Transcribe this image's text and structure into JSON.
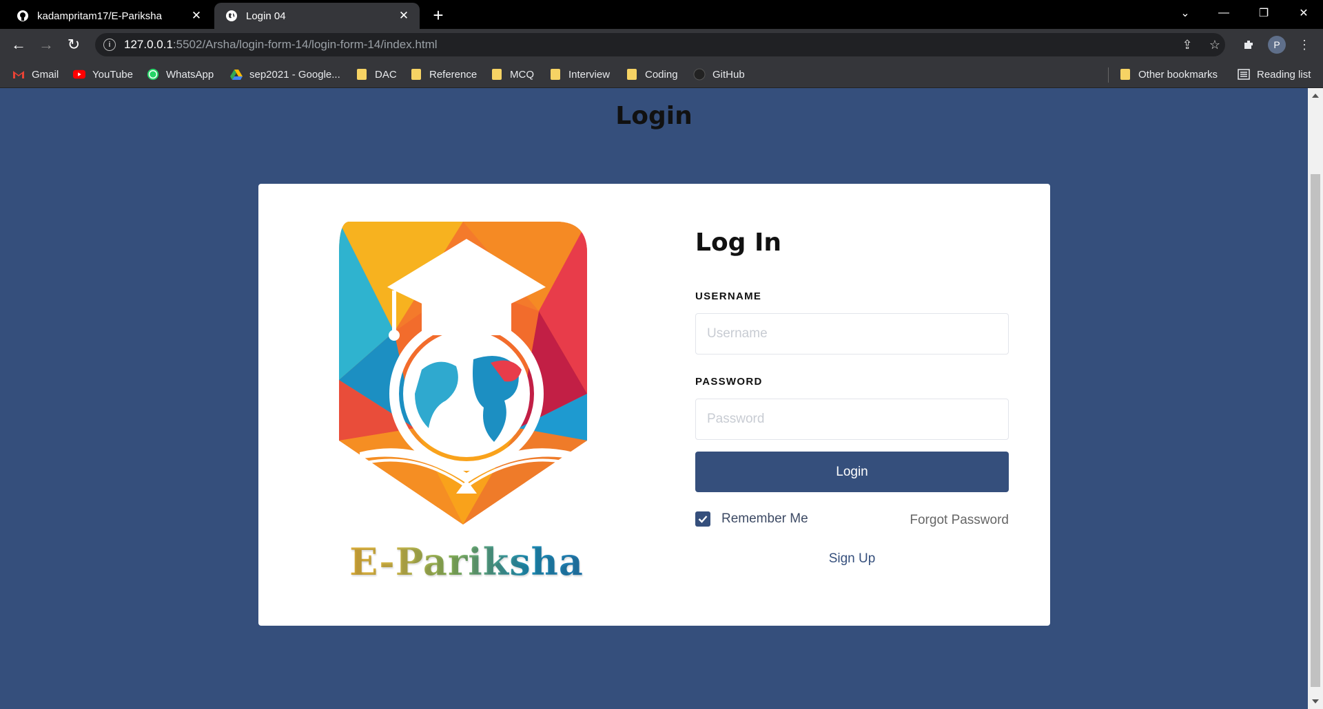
{
  "browser": {
    "tabs": [
      {
        "title": "kadampritam17/E-Pariksha",
        "icon": "github-icon",
        "active": false
      },
      {
        "title": "Login 04",
        "icon": "globe-icon",
        "active": true
      }
    ],
    "url_host": "127.0.0.1",
    "url_rest": ":5502/Arsha/login-form-14/login-form-14/index.html",
    "profile_initial": "P",
    "bookmarks": [
      {
        "label": "Gmail",
        "icon": "gmail-icon"
      },
      {
        "label": "YouTube",
        "icon": "youtube-icon"
      },
      {
        "label": "WhatsApp",
        "icon": "whatsapp-icon"
      },
      {
        "label": "sep2021 - Google...",
        "icon": "google-drive-icon"
      },
      {
        "label": "DAC",
        "icon": "folder-icon"
      },
      {
        "label": "Reference",
        "icon": "folder-icon"
      },
      {
        "label": "MCQ",
        "icon": "folder-icon"
      },
      {
        "label": "Interview",
        "icon": "folder-icon"
      },
      {
        "label": "Coding",
        "icon": "folder-icon"
      },
      {
        "label": "GitHub",
        "icon": "github-icon"
      }
    ],
    "other_bookmarks": "Other bookmarks",
    "reading_list": "Reading list"
  },
  "page": {
    "heading": "Login",
    "brand": "E-Pariksha",
    "form": {
      "title": "Log In",
      "username_label": "USERNAME",
      "username_placeholder": "Username",
      "password_label": "PASSWORD",
      "password_placeholder": "Password",
      "submit_label": "Login",
      "remember_label": "Remember Me",
      "remember_checked": true,
      "forgot_label": "Forgot Password",
      "signup_label": "Sign Up"
    }
  },
  "colors": {
    "page_bg": "#354f7c",
    "button_bg": "#354f7c",
    "card_bg": "#ffffff"
  }
}
